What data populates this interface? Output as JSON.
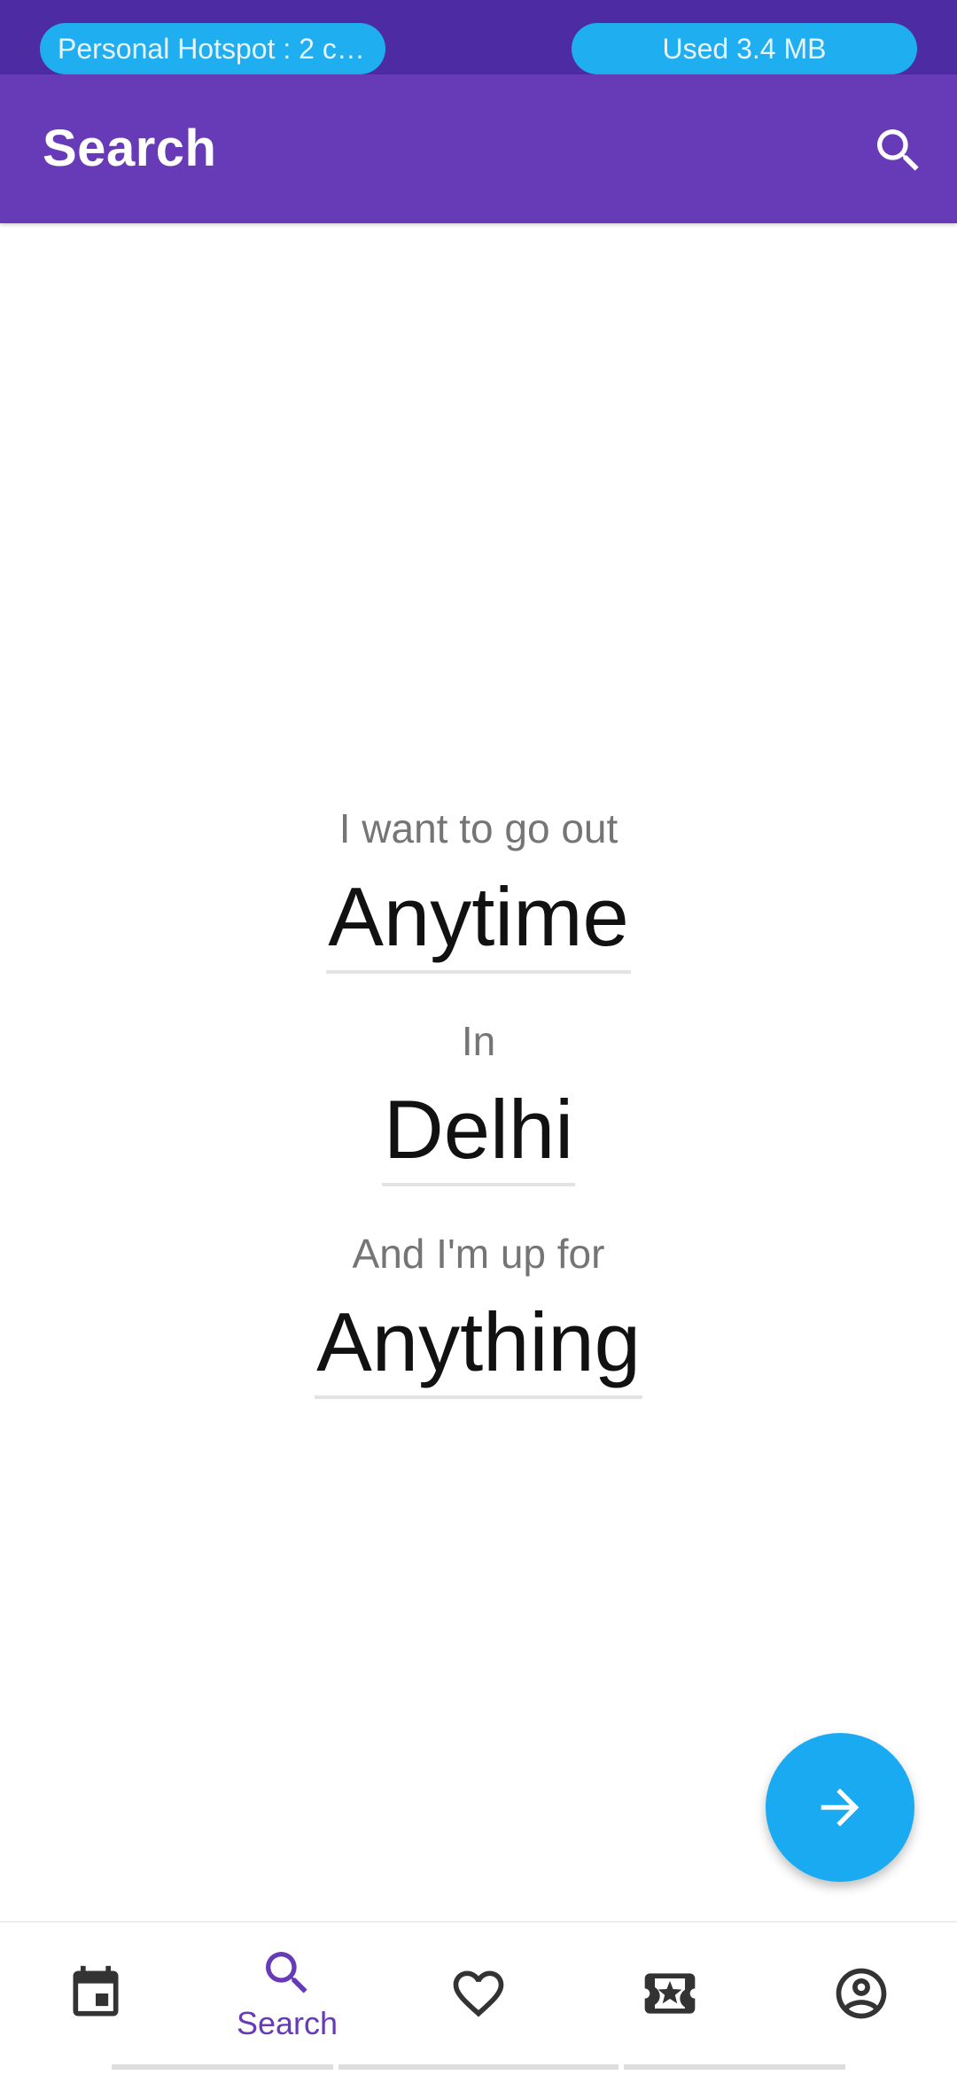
{
  "status_bar": {
    "hotspot": "Personal Hotspot : 2 co...",
    "usage": "Used  3.4 MB"
  },
  "app_bar": {
    "title": "Search",
    "icon": "search-icon"
  },
  "sentence": {
    "prompt_when": "I want to go out",
    "when": "Anytime",
    "prompt_where": "In",
    "where": "Delhi",
    "prompt_what": "And I'm up for",
    "what": "Anything"
  },
  "fab": {
    "icon": "arrow-right-icon"
  },
  "bottom_nav": {
    "items": [
      {
        "icon": "calendar-icon",
        "label": ""
      },
      {
        "icon": "search-icon",
        "label": "Search",
        "active": true
      },
      {
        "icon": "heart-icon",
        "label": ""
      },
      {
        "icon": "ticket-star-icon",
        "label": ""
      },
      {
        "icon": "account-circle-icon",
        "label": ""
      }
    ]
  },
  "colors": {
    "primary": "#673ab7",
    "primary_dark": "#4c2ba3",
    "accent": "#1aaaf2"
  }
}
